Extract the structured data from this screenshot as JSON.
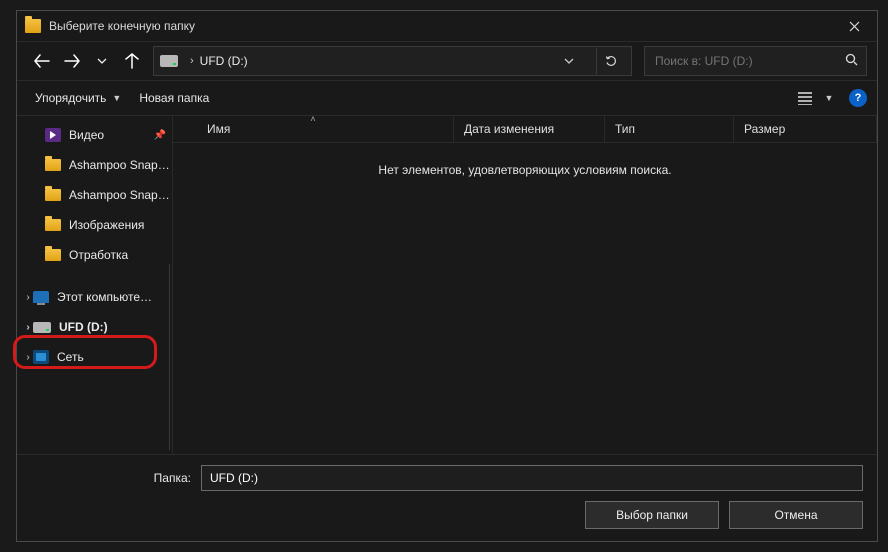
{
  "title": "Выберите конечную папку",
  "address": {
    "drive_label": "UFD (D:)"
  },
  "search": {
    "placeholder": "Поиск в: UFD (D:)"
  },
  "toolbar": {
    "organize": "Упорядочить",
    "new_folder": "Новая папка"
  },
  "sidebar": {
    "video": "Видео",
    "snap1": "Ashampoo Snap…",
    "snap2": "Ashampoo Snap…",
    "images": "Изображения",
    "work": "Отработка",
    "this_pc": "Этот компьюте…",
    "ufd": "UFD (D:)",
    "network": "Сеть"
  },
  "columns": {
    "name": "Имя",
    "date": "Дата изменения",
    "type": "Тип",
    "size": "Размер"
  },
  "empty_msg": "Нет элементов, удовлетворяющих условиям поиска.",
  "footer": {
    "folder_label": "Папка:",
    "folder_value": "UFD (D:)",
    "select": "Выбор папки",
    "cancel": "Отмена"
  }
}
